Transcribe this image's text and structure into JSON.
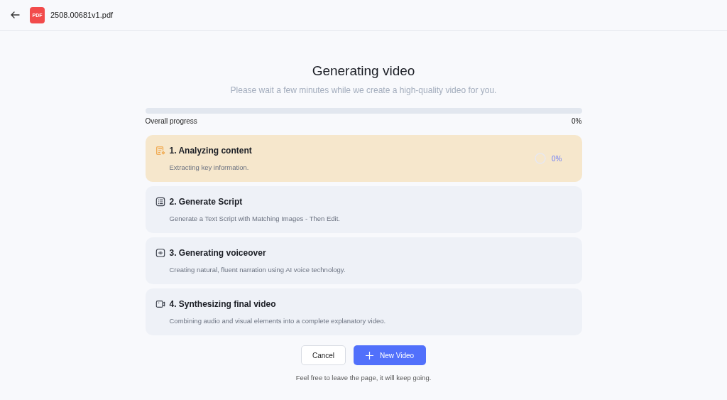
{
  "header": {
    "file_badge": "PDF",
    "file_name": "2508.00681v1.pdf"
  },
  "title": "Generating video",
  "subtitle": "Please wait a few minutes while we create a high-quality video for you.",
  "progress": {
    "level": 0,
    "label": "Overall progress",
    "reading": "0%"
  },
  "steps": [
    {
      "kind": "analyze",
      "title": "1. Analyzing content",
      "description": "Extracting key information.",
      "active": true,
      "percent": "0%"
    },
    {
      "kind": "script",
      "title": "2. Generate Script",
      "description": "Generate a Text Script with Matching Images - Then Edit.",
      "active": false
    },
    {
      "kind": "voice",
      "title": "3. Generating voiceover",
      "description": "Creating natural, fluent narration using AI voice technology.",
      "active": false
    },
    {
      "kind": "video",
      "title": "4. Synthesizing final video",
      "description": "Combining audio and visual elements into a complete explanatory video.",
      "active": false
    }
  ],
  "buttons": {
    "cancel": "Cancel",
    "primary": "New Video"
  },
  "footer_note": "Feel free to leave the page, it will keep going."
}
